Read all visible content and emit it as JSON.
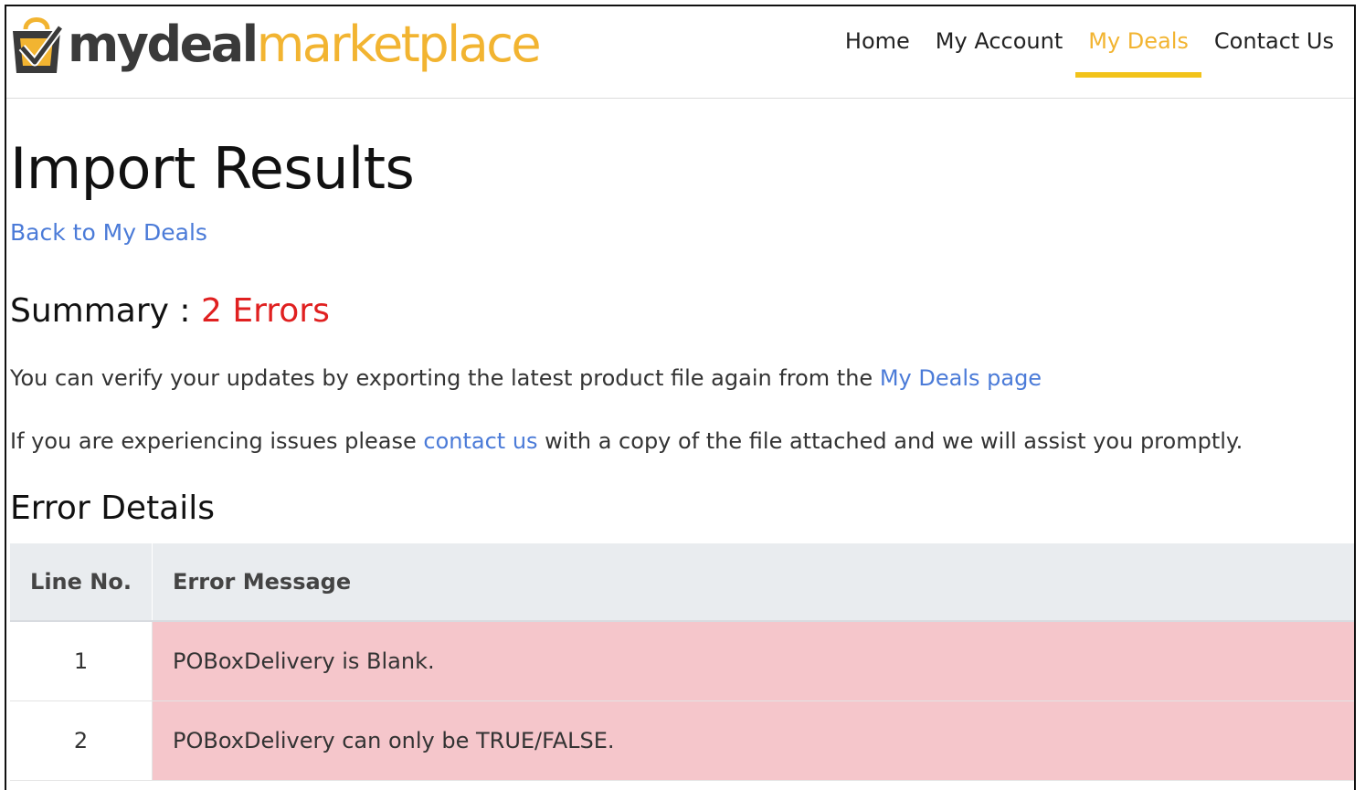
{
  "header": {
    "logo": {
      "part1": "mydeal",
      "part2": "marketplace"
    },
    "nav": [
      {
        "label": "Home",
        "active": false
      },
      {
        "label": "My Account",
        "active": false
      },
      {
        "label": "My Deals",
        "active": true
      },
      {
        "label": "Contact Us",
        "active": false
      }
    ]
  },
  "page": {
    "title": "Import Results",
    "back_link": "Back to My Deals",
    "summary_label": "Summary : ",
    "summary_errors": "2 Errors",
    "verify_text": "You can verify your updates by exporting the latest product file again from the ",
    "verify_link": "My Deals page",
    "issues_pre": "If you are experiencing issues please ",
    "issues_link": "contact us",
    "issues_post": " with a copy of the file attached and we will assist you promptly.",
    "details_heading": "Error Details"
  },
  "table": {
    "headers": [
      "Line No.",
      "Error Message"
    ],
    "rows": [
      {
        "line": "1",
        "message": "POBoxDelivery is Blank."
      },
      {
        "line": "2",
        "message": "POBoxDelivery can only be TRUE/FALSE."
      }
    ]
  },
  "colors": {
    "brand_yellow": "#f2b431",
    "link_blue": "#4b7bd8",
    "error_red": "#e02020",
    "error_row_bg": "#f5c6cb",
    "table_header_bg": "#e9ecef"
  }
}
